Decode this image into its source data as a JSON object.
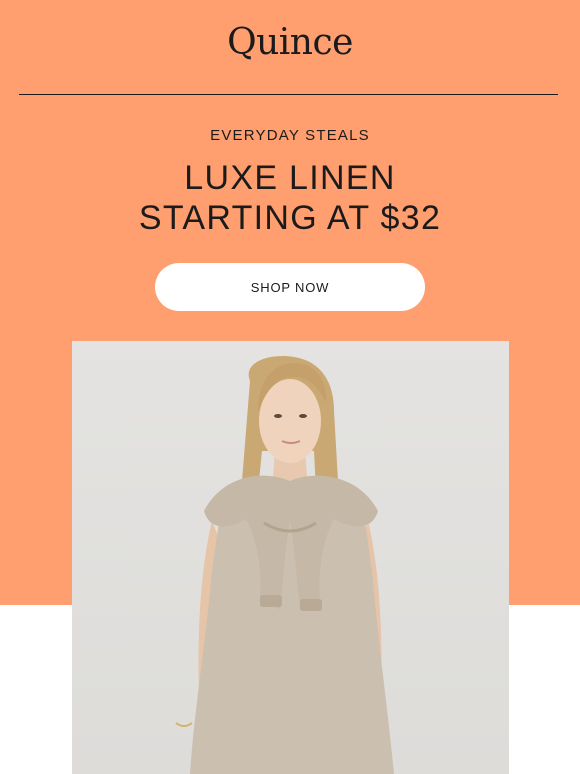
{
  "brand": {
    "logo_text": "Quince"
  },
  "hero": {
    "eyebrow": "EVERYDAY STEALS",
    "headline_line1": "LUXE LINEN",
    "headline_line2": "STARTING AT $32",
    "cta_label": "SHOP NOW",
    "background_color": "#FF9E6F"
  },
  "product_image": {
    "subject": "model wearing linen dress with sweater draped over shoulders"
  }
}
